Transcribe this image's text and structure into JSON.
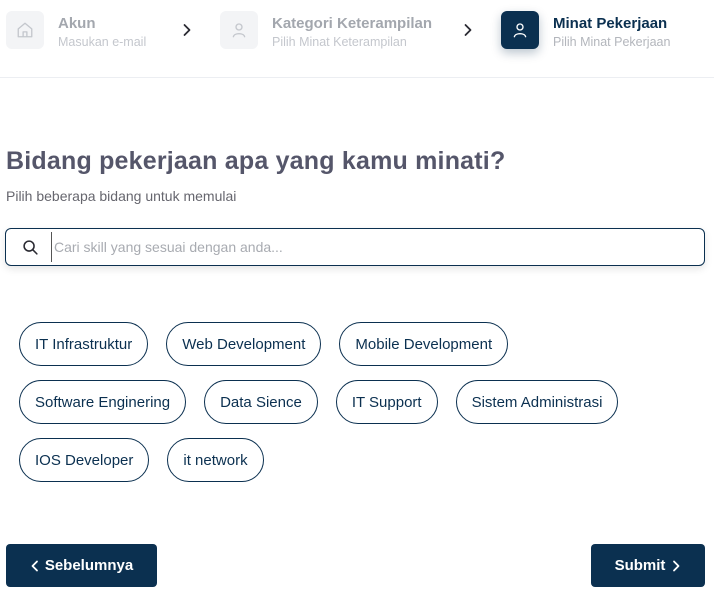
{
  "stepper": {
    "steps": [
      {
        "title": "Akun",
        "subtitle": "Masukan e-mail",
        "icon": "home-icon",
        "active": false
      },
      {
        "title": "Kategori Keterampilan",
        "subtitle": "Pilih Minat Keterampilan",
        "icon": "user-icon",
        "active": false
      },
      {
        "title": "Minat Pekerjaan",
        "subtitle": "Pilih Minat Pekerjaan",
        "icon": "user-icon",
        "active": true
      }
    ]
  },
  "main": {
    "heading": "Bidang pekerjaan apa yang kamu minati?",
    "subheading": "Pilih beberapa bidang untuk memulai"
  },
  "search": {
    "placeholder": "Cari skill yang sesuai dengan anda...",
    "value": ""
  },
  "chips": [
    [
      "IT Infrastruktur",
      "Web Development",
      "Mobile Development"
    ],
    [
      "Software Enginering",
      "Data Sience",
      "IT Support",
      "Sistem Administrasi"
    ],
    [
      "IOS Developer",
      "it network"
    ]
  ],
  "footer": {
    "prev_label": "Sebelumnya",
    "next_label": "Submit"
  },
  "colors": {
    "primary": "#0b3050",
    "heading": "#55566a",
    "inactive_icon_bg": "#f3f4f6"
  }
}
